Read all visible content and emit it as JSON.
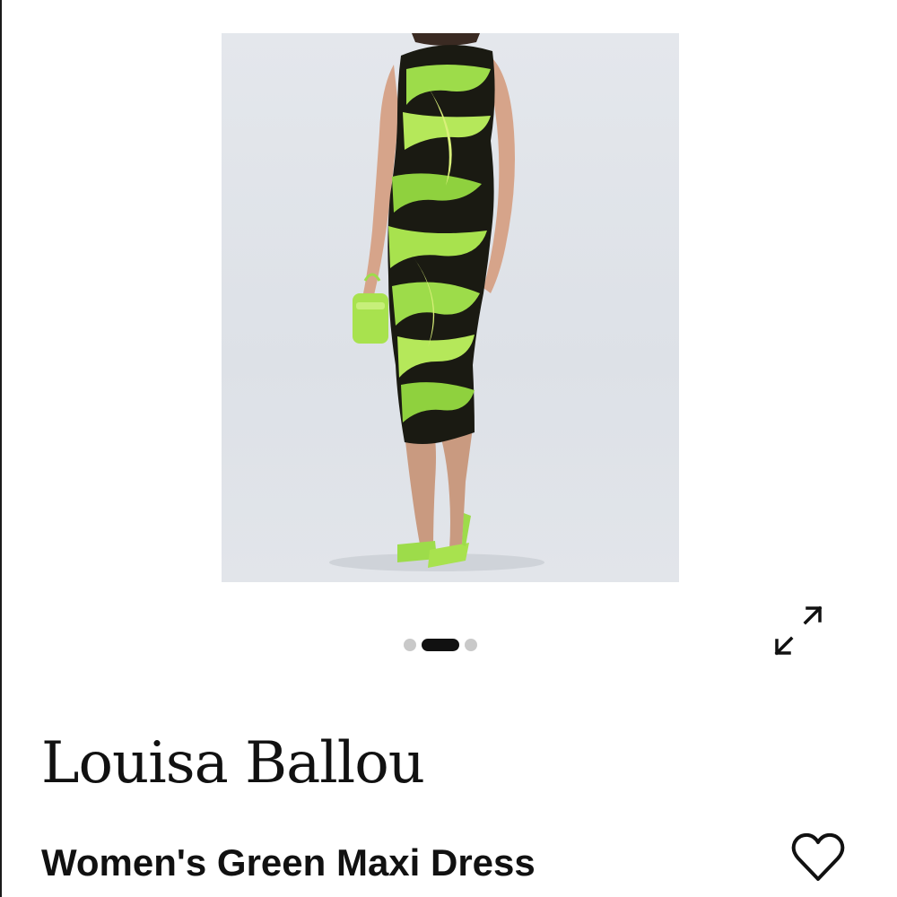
{
  "product": {
    "brand": "Louisa Ballou",
    "name": "Women's Green Maxi Dress",
    "image_alt": "Model wearing green and black tropical print sleeveless mesh maxi dress with lime green pumps and mini bag"
  },
  "gallery": {
    "image_count": 3,
    "active_index": 1
  },
  "icons": {
    "expand": "expand-arrows-icon",
    "wishlist": "heart-outline-icon"
  },
  "colors": {
    "text": "#111111",
    "dot_inactive": "#c9c9c9",
    "dot_active": "#111111",
    "dress_green": "#9ddc4a",
    "dress_black": "#1a1a12"
  }
}
